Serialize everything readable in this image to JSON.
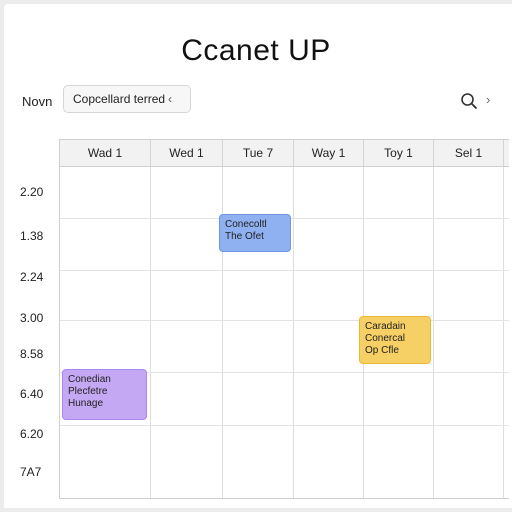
{
  "app": {
    "title": "Ccanet UP"
  },
  "toolbar": {
    "nav_label": "Novn",
    "dropdown_value": "Copcellard terred",
    "dropdown_chevron": "‹"
  },
  "icons": {
    "search": "search-icon",
    "next": "chevron-right-icon"
  },
  "calendar": {
    "days": [
      "Wad 1",
      "Wed 1",
      "Tue 7",
      "Way 1",
      "Toy 1",
      "Sel 1"
    ],
    "times": [
      "2.20",
      "1.38",
      "2.24",
      "3.00",
      "8.58",
      "6.40",
      "6.20",
      "7A7"
    ]
  },
  "events": [
    {
      "lines": [
        "Conecoltl",
        "The Ofet"
      ],
      "color": "#8fb1f2"
    },
    {
      "lines": [
        "Caradain",
        "Conercal",
        "Op Cfle"
      ],
      "color": "#f6d065"
    },
    {
      "lines": [
        "Conedian",
        "Plecfetre",
        "Hunage"
      ],
      "color": "#c5a8f3"
    }
  ]
}
